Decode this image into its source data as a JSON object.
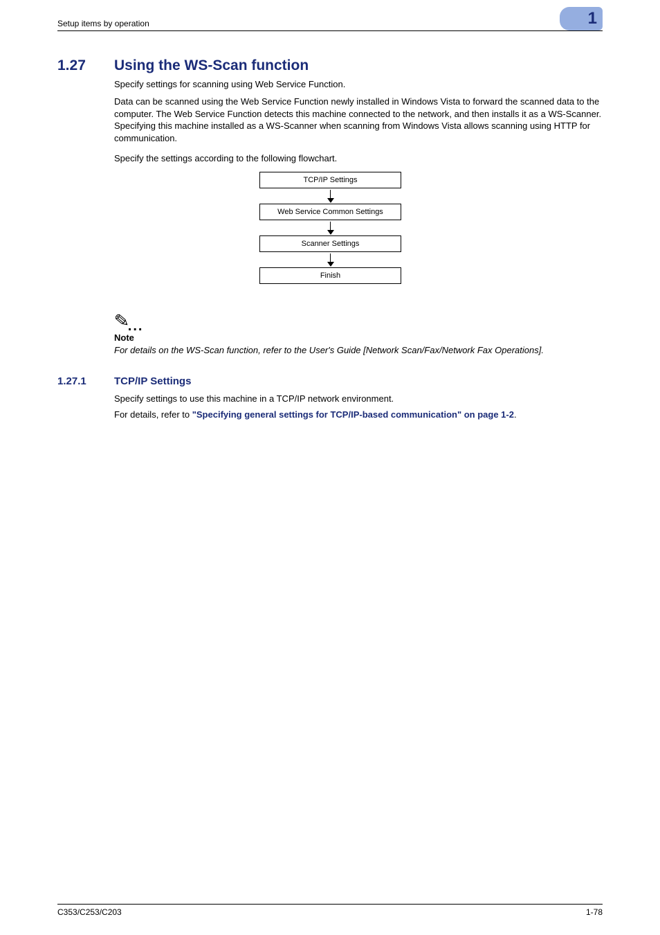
{
  "header": {
    "breadcrumb": "Setup items by operation",
    "chapter_num": "1"
  },
  "section": {
    "number": "1.27",
    "title": "Using the WS-Scan function"
  },
  "paragraphs": {
    "intro": "Specify settings for scanning using Web Service Function.",
    "desc": "Data can be scanned using the Web Service Function newly installed in Windows Vista to forward the scanned data to the computer. The Web Service Function detects this machine connected to the network, and then installs it as a WS-Scanner. Specifying this machine installed as a WS-Scanner when scanning from Windows Vista allows scanning using HTTP for communication.",
    "flow_intro": "Specify the settings according to the following flowchart."
  },
  "flowchart": {
    "step1": "TCP/IP Settings",
    "step2": "Web Service Common Settings",
    "step3": "Scanner Settings",
    "step4": "Finish"
  },
  "note": {
    "label": "Note",
    "text": "For details on the WS-Scan function, refer to the User's Guide [Network Scan/Fax/Network Fax Operations]."
  },
  "subsection": {
    "number": "1.27.1",
    "title": "TCP/IP Settings",
    "p1": "Specify settings to use this machine in a TCP/IP network environment.",
    "p2_prefix": "For details, refer to ",
    "p2_link": "\"Specifying general settings for TCP/IP-based communication\" on page 1-2",
    "p2_suffix": "."
  },
  "footer": {
    "left": "C353/C253/C203",
    "right": "1-78"
  }
}
